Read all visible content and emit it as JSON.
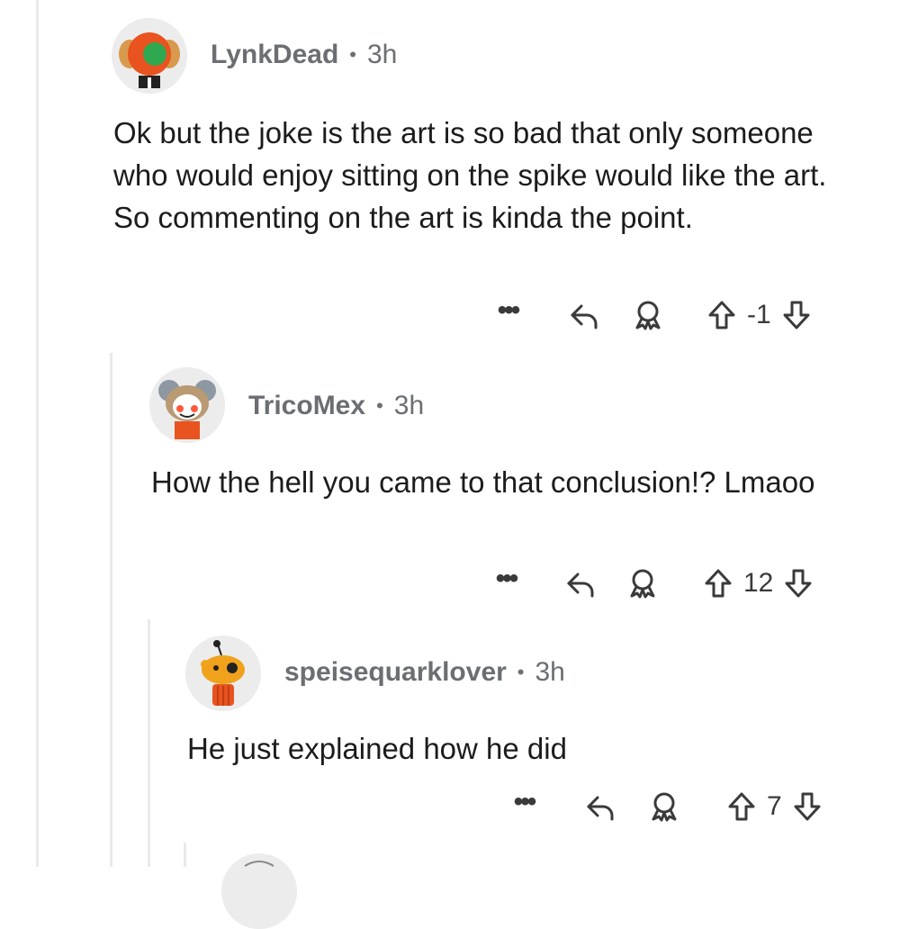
{
  "comments": [
    {
      "user": "LynkDead",
      "separator": "•",
      "time": "3h",
      "text": "Ok but the joke is the art is so bad that only someone who would enjoy sitting on the spike would like the art. So commenting on the art is kinda the point.",
      "score": "-1",
      "more_label": "•••"
    },
    {
      "user": "TricoMex",
      "separator": "•",
      "time": "3h",
      "text": "How the hell you came to that conclusion!? Lmaoo",
      "score": "12",
      "more_label": "•••"
    },
    {
      "user": "speisequarklover",
      "separator": "•",
      "time": "3h",
      "text": "He just explained how he did",
      "score": "7",
      "more_label": "•••"
    }
  ],
  "icons": {
    "more": "more-options-icon",
    "reply": "reply-arrow-icon",
    "award": "award-icon",
    "upvote": "upvote-arrow-icon",
    "downvote": "downvote-arrow-icon"
  },
  "colors": {
    "meta_text": "#6b6e72",
    "body_text": "#1c1c1c",
    "thread_line": "#e9e9ea",
    "icon": "#3a3a3a"
  }
}
